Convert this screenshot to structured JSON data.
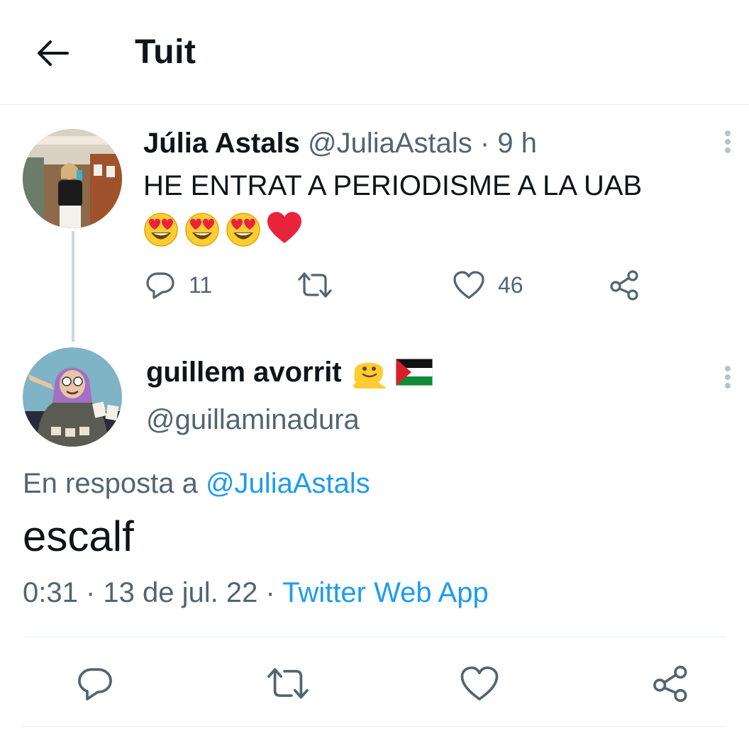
{
  "header": {
    "title": "Tuit"
  },
  "original_tweet": {
    "display_name": "Júlia Astals",
    "handle": "@JuliaAstals",
    "separator": "·",
    "time": "9 h",
    "text": "HE ENTRAT A PERIODISME A LA UAB",
    "emojis": [
      "heart-eyes-emoji",
      "heart-eyes-emoji",
      "heart-eyes-emoji",
      "red-heart-emoji"
    ],
    "actions": {
      "reply_count": "11",
      "like_count": "46"
    }
  },
  "reply_tweet": {
    "display_name": "guillem avorrit",
    "name_icons": [
      "melting-face-emoji",
      "palestine-flag-emoji"
    ],
    "handle": "@guillaminadura",
    "replying_to_label": "En resposta a",
    "replying_to_handle": "@JuliaAstals",
    "text": "escalf",
    "timestamp": "0:31 · 13 de jul. 22",
    "meta_separator": "·",
    "source": "Twitter Web App"
  },
  "colors": {
    "text": "#0f1419",
    "secondary": "#536471",
    "link": "#1d9bf0",
    "border": "#e6ecf0"
  }
}
